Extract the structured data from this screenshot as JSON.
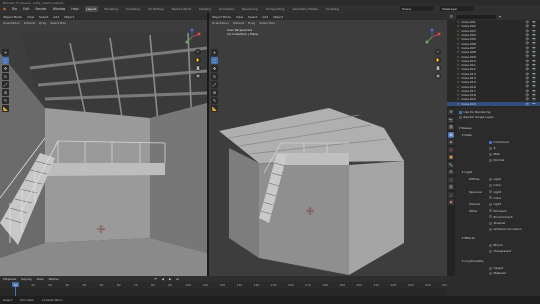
{
  "window": {
    "title": "Blender [C:\\Users\\...\\stair_interior.blend]"
  },
  "menubar": {
    "menus": [
      "File",
      "Edit",
      "Render",
      "Window",
      "Help"
    ],
    "workspaces": [
      "Layout",
      "Modeling",
      "Sculpting",
      "UV Editing",
      "Texture Paint",
      "Shading",
      "Animation",
      "Rendering",
      "Compositing",
      "Geometry Nodes",
      "Scripting"
    ],
    "active_workspace": "Layout",
    "scene": "Scene",
    "view_layer": "ViewLayer"
  },
  "viewport_left": {
    "header": [
      "Object Mode",
      "View",
      "Select",
      "Add",
      "Object"
    ],
    "sub": [
      "Orientation",
      "Default",
      "Drag",
      "Select Box"
    ],
    "info_line1": "User Perspective",
    "info_line2": "(1) Collection | Plane"
  },
  "viewport_right": {
    "header": [
      "Object Mode",
      "View",
      "Select",
      "Add",
      "Object"
    ],
    "sub": [
      "Orientation",
      "Default",
      "Drag",
      "Select Box"
    ],
    "info_line1": "User Perspective",
    "info_line2": "(1) Collection | Plane"
  },
  "outliner": {
    "search_placeholder": "",
    "items": [
      "Cube.001",
      "Cube.002",
      "Cube.003",
      "Cube.004",
      "Cube.005",
      "Cube.006",
      "Cube.007",
      "Cube.008",
      "Cube.009",
      "Cube.010",
      "Cube.011",
      "Cube.012",
      "Cube.013",
      "Cube.014",
      "Cube.015",
      "Cube.016",
      "Cube.017",
      "Cube.018",
      "Cube.019",
      "Cube.020"
    ]
  },
  "properties": {
    "top_checks": [
      "Use for Rendering",
      "Render Single Layer"
    ],
    "passes_title": "Passes",
    "data_title": "Data",
    "data_checks": [
      {
        "label": "Combined",
        "on": true
      },
      {
        "label": "Z",
        "on": false
      },
      {
        "label": "Mist",
        "on": false
      },
      {
        "label": "Normal",
        "on": false
      }
    ],
    "light_title": "Light",
    "light_rows": [
      {
        "label": "Diffuse",
        "value": "Light"
      },
      {
        "label": "",
        "value": "Color"
      },
      {
        "label": "Specular",
        "value": "Light"
      },
      {
        "label": "",
        "value": "Color"
      },
      {
        "label": "Volume",
        "value": "Light"
      },
      {
        "label": "Other",
        "value": "Emission"
      },
      {
        "label": "",
        "value": "Environment"
      },
      {
        "label": "",
        "value": "Shadow"
      },
      {
        "label": "",
        "value": "Ambient Occlusion"
      }
    ],
    "effects_title": "Effects",
    "effects_rows": [
      "Bloom",
      "Transparent"
    ],
    "cryptomatte_title": "Cryptomatte",
    "cryptomatte_rows": [
      "Object",
      "Material",
      "Asset"
    ]
  },
  "timeline": {
    "header": [
      "Playback",
      "Keying",
      "View",
      "Marker"
    ],
    "ticks": [
      "0",
      "10",
      "20",
      "30",
      "40",
      "50",
      "60",
      "70",
      "80",
      "90",
      "100",
      "110",
      "120",
      "130",
      "140",
      "150",
      "160",
      "170",
      "180",
      "190",
      "200",
      "210",
      "220",
      "230",
      "240",
      "250"
    ],
    "current_frame_position": "10"
  },
  "status_bar": {
    "items": [
      "Select",
      "Pan View",
      "Context Menu"
    ]
  },
  "colors": {
    "accent": "#4772b3",
    "viewport_bg": "#3d3d3d",
    "outliner_selected": "#334d80"
  }
}
